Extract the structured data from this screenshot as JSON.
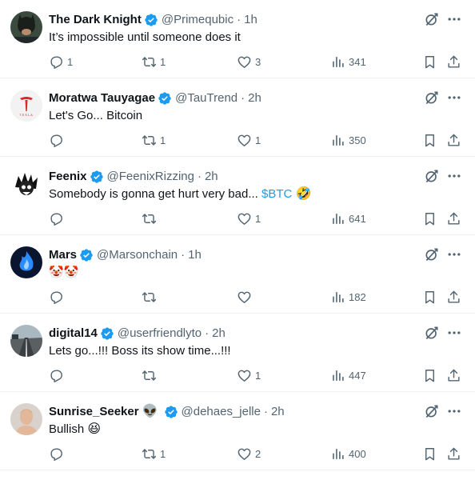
{
  "colors": {
    "accent": "#1d9bf0",
    "text": "#0f1419",
    "muted": "#536471",
    "divider": "#eff3f4"
  },
  "tweets": [
    {
      "name": "The Dark Knight",
      "handle": "@Primequbic",
      "time": "1h",
      "text": "It’s impossible until someone does it",
      "replies": "1",
      "reposts": "1",
      "likes": "3",
      "views": "341",
      "avatar": "dark-knight-avatar"
    },
    {
      "name": "Moratwa Tauyagae",
      "handle": "@TauTrend",
      "time": "2h",
      "text": "Let's Go... Bitcoin",
      "replies": "",
      "reposts": "1",
      "likes": "1",
      "views": "350",
      "avatar": "tesla-logo-avatar",
      "avatar_text": "TESLA"
    },
    {
      "name": "Feenix",
      "handle": "@FeenixRizzing",
      "time": "2h",
      "text": "Somebody is gonna get hurt very bad... ",
      "cashtag": "$BTC",
      "emoji": "🤣",
      "replies": "",
      "reposts": "",
      "likes": "1",
      "views": "641",
      "avatar": "feenix-mascot-avatar"
    },
    {
      "name": "Mars",
      "handle": "@Marsonchain",
      "time": "1h",
      "text": "🤡🤡",
      "replies": "",
      "reposts": "",
      "likes": "",
      "views": "182",
      "avatar": "blue-flame-avatar"
    },
    {
      "name": "digital14",
      "handle": "@userfriendlyto",
      "time": "2h",
      "text": "Lets go...!!!  Boss its show time...!!!",
      "replies": "",
      "reposts": "",
      "likes": "1",
      "views": "447",
      "avatar": "road-landscape-avatar"
    },
    {
      "name": "Sunrise_Seeker",
      "name_emoji": "👽",
      "handle": "@dehaes_jelle",
      "time": "2h",
      "text": "Bullish ",
      "emoji": "😆",
      "replies": "",
      "reposts": "1",
      "likes": "2",
      "views": "400",
      "avatar": "person-photo-avatar"
    }
  ],
  "icons": {
    "verified": "verified-badge-icon",
    "grok": "grok-icon",
    "more": "more-icon",
    "reply": "reply-icon",
    "repost": "repost-icon",
    "like": "like-icon",
    "views": "views-icon",
    "bookmark": "bookmark-icon",
    "share": "share-icon"
  },
  "separator": "·"
}
